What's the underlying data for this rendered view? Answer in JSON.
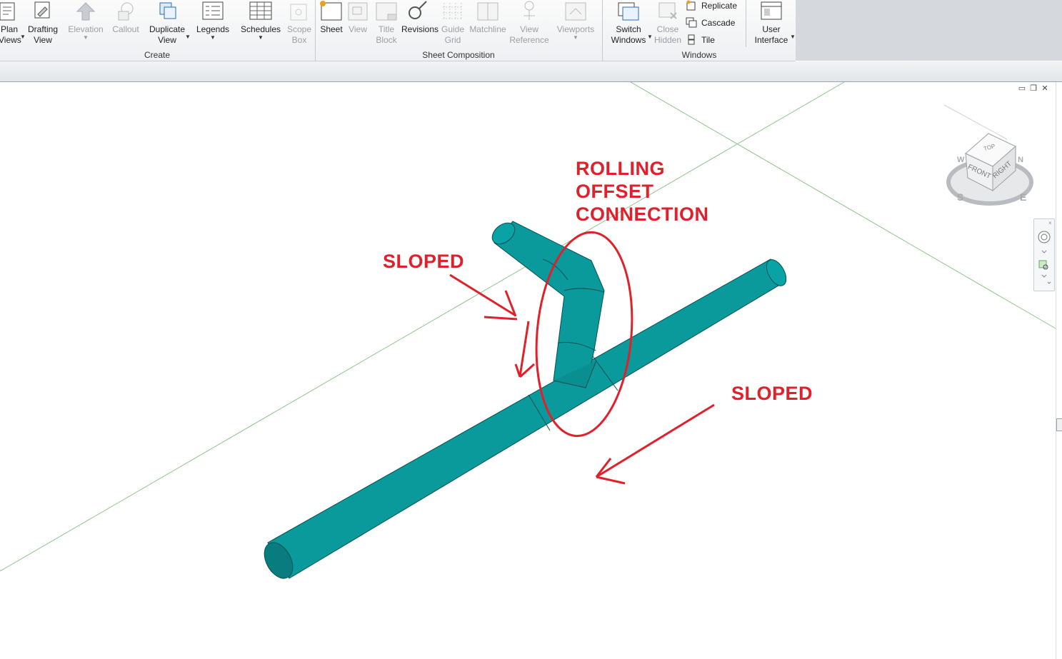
{
  "ribbon": {
    "panels": {
      "create": "Create",
      "sheet_composition": "Sheet Composition",
      "windows": "Windows"
    },
    "tools": {
      "plan_views": "Plan\nViews",
      "drafting_view": "Drafting\nView",
      "elevation": "Elevation",
      "callout": "Callout",
      "duplicate_view": "Duplicate\nView",
      "legends": "Legends",
      "schedules": "Schedules",
      "scope_box": "Scope\nBox",
      "sheet": "Sheet",
      "view": "View",
      "title_block": "Title\nBlock",
      "revisions": "Revisions",
      "guide_grid": "Guide\nGrid",
      "matchline": "Matchline",
      "view_reference": "View\nReference",
      "viewports": "Viewports",
      "switch_windows": "Switch\nWindows",
      "close_hidden": "Close\nHidden",
      "replicate": "Replicate",
      "cascade": "Cascade",
      "tile": "Tile",
      "user_interface": "User\nInterface"
    }
  },
  "viewcube": {
    "top": "TOP",
    "front": "FRONT",
    "right": "RIGHT",
    "compass_s": "S",
    "compass_e": "E",
    "compass_w": "W",
    "compass_n": "N"
  },
  "annotations": {
    "rolling_offset": "ROLLING\nOFFSET\nCONNECTION",
    "sloped_left": "SLOPED",
    "sloped_right": "SLOPED"
  },
  "colors": {
    "pipe": "#0a9a9c",
    "pipe_dark": "#087c7e",
    "annotation": "#e0202a"
  }
}
